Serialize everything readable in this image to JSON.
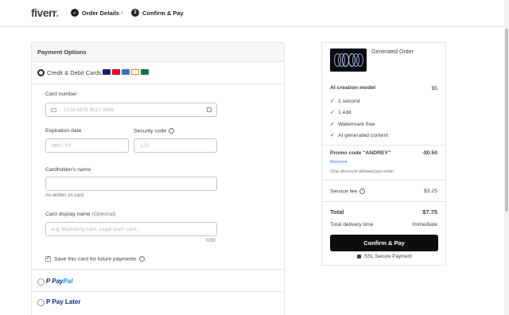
{
  "header": {
    "logo_text": "fiverr",
    "logo_dot": ".",
    "step1_label": "Order Details",
    "step2_number": "2",
    "step2_label": "Confirm & Pay"
  },
  "payment": {
    "title": "Payment Options",
    "method_cards_label": "Credit & Debit Cards",
    "card_brands": [
      "VISA",
      "MC",
      "AMEX",
      "DISC",
      "JCB"
    ],
    "card_number_label": "Card number",
    "card_number_placeholder": "1234 5678 9012 3456",
    "expiration_label": "Expiration date",
    "expiration_placeholder": "MM / YY",
    "security_label": "Security code",
    "security_placeholder": "123",
    "holder_label": "Cardholder's name",
    "holder_hint": "As written on card",
    "display_label": "Card display name",
    "display_optional": "(Optional)",
    "display_placeholder": "e.g. Marketing card, Legal team card...",
    "display_counter": "0/30",
    "save_card_label": "Save this card for future payments",
    "paypal_a": "Pay",
    "paypal_b": "Pal",
    "paylater_label": "Pay Later"
  },
  "summary": {
    "title": "Generated Order",
    "model_label": "AI creation model",
    "model_price": "$5",
    "features": [
      "1 second",
      "1 edit",
      "Watermark free",
      "AI generated content"
    ],
    "promo_label": "Promo code \"ANDREY\"",
    "promo_value": "-$0.50",
    "remove_label": "Remove",
    "promo_note": "One discount allowed per order",
    "service_fee_label": "Service fee",
    "service_fee_value": "$3.25",
    "total_label": "Total",
    "total_value": "$7.75",
    "delivery_label": "Total delivery time",
    "delivery_value": "Immediate",
    "confirm_button": "Confirm & Pay",
    "ssl_label": "SSL Secure Payment"
  },
  "colors": {
    "brand_green": "#1dbf73",
    "button_black": "#0d0d0d",
    "link_blue": "#446ee7",
    "paypal_dark": "#003087",
    "paypal_light": "#009cde"
  }
}
